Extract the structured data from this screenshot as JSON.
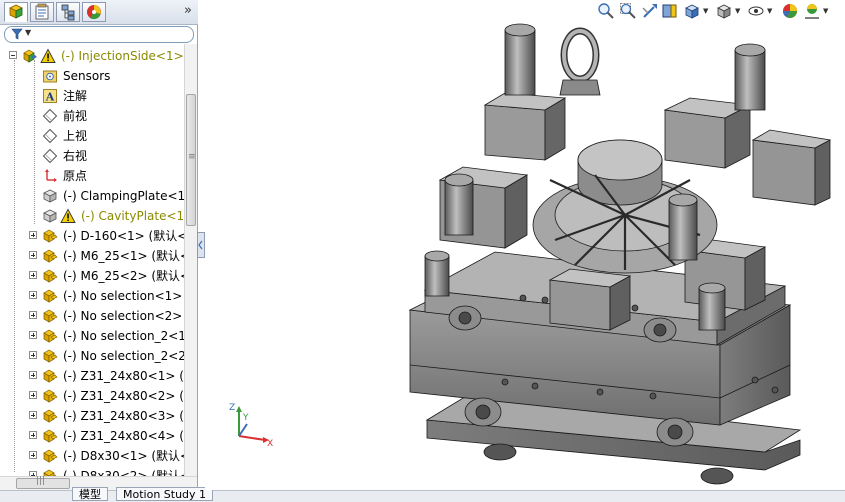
{
  "panel": {
    "more_glyph": "»",
    "tabs": [
      {
        "name": "featuremanager-tab",
        "icon": "feature-tree-icon"
      },
      {
        "name": "propertymanager-tab",
        "icon": "property-manager-icon"
      },
      {
        "name": "configuration-tab",
        "icon": "configuration-icon"
      },
      {
        "name": "appearance-tab",
        "icon": "appearance-icon"
      }
    ]
  },
  "tree": {
    "root": {
      "label": "(-) InjectionSide<1>",
      "warning": true
    },
    "children": [
      {
        "label": "Sensors",
        "icon": "sensors-folder-icon"
      },
      {
        "label": "注解",
        "icon": "annotations-icon"
      },
      {
        "label": "前视",
        "icon": "plane-icon"
      },
      {
        "label": "上视",
        "icon": "plane-icon"
      },
      {
        "label": "右视",
        "icon": "plane-icon"
      },
      {
        "label": "原点",
        "icon": "origin-icon"
      },
      {
        "label": "(-) ClampingPlate<1",
        "icon": "part-icon"
      },
      {
        "label": "(-) CavityPlate<1>",
        "icon": "part-icon",
        "warning": true
      },
      {
        "label": "(-) D-160<1> (默认<",
        "icon": "assembly-icon",
        "expandable": true
      },
      {
        "label": "(-) M6_25<1> (默认<",
        "icon": "assembly-icon",
        "expandable": true
      },
      {
        "label": "(-) M6_25<2> (默认<",
        "icon": "assembly-icon",
        "expandable": true
      },
      {
        "label": "(-) No selection<1>",
        "icon": "assembly-icon",
        "expandable": true
      },
      {
        "label": "(-) No selection<2>",
        "icon": "assembly-icon",
        "expandable": true
      },
      {
        "label": "(-) No selection_2<1",
        "icon": "assembly-icon",
        "expandable": true
      },
      {
        "label": "(-) No selection_2<2",
        "icon": "assembly-icon",
        "expandable": true
      },
      {
        "label": "(-) Z31_24x80<1> (默",
        "icon": "assembly-icon",
        "expandable": true
      },
      {
        "label": "(-) Z31_24x80<2> (默",
        "icon": "assembly-icon",
        "expandable": true
      },
      {
        "label": "(-) Z31_24x80<3> (默",
        "icon": "assembly-icon",
        "expandable": true
      },
      {
        "label": "(-) Z31_24x80<4> (默",
        "icon": "assembly-icon",
        "expandable": true
      },
      {
        "label": "(-) D8x30<1> (默认<",
        "icon": "assembly-icon",
        "expandable": true
      },
      {
        "label": "(-) D8x30<2> (默认<",
        "icon": "assembly-icon",
        "expandable": true
      }
    ]
  },
  "scrollbar": {
    "grip": "≡",
    "hgrip": "|||"
  },
  "bottom_tabs": [
    "模型",
    "Motion Study 1"
  ],
  "heads_up_toolbar": [
    "zoom-to-fit-icon",
    "zoom-area-icon",
    "previous-view-icon",
    "section-view-icon",
    "view-orientation-icon",
    "display-style-icon",
    "hide-show-icon",
    "appearance-edit-icon",
    "scene-icon"
  ],
  "triad": {
    "x": "X",
    "y": "Y",
    "z": "Z"
  },
  "colors": {
    "warning": "#f5d000",
    "part_yellow": "#f0c419",
    "model_gray": "#8a8a8a",
    "accent_blue": "#3a6fb5"
  }
}
